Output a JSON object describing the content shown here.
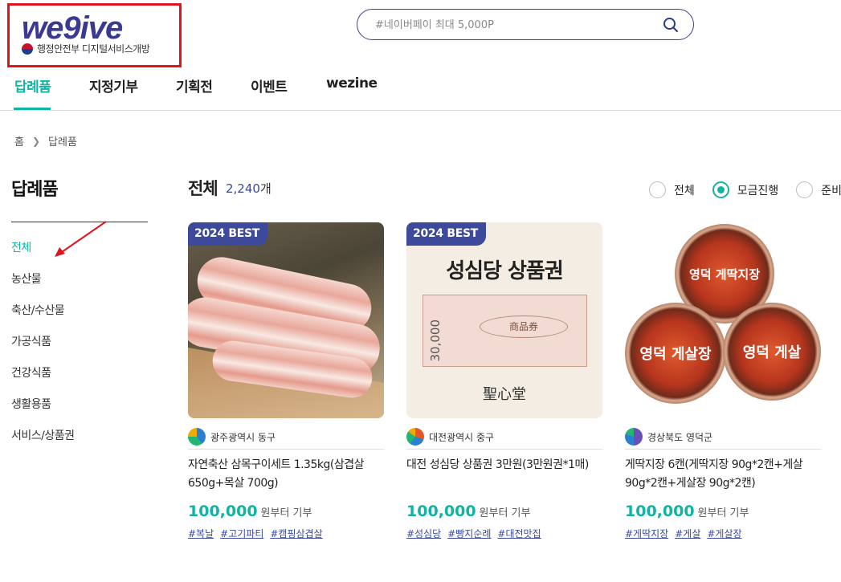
{
  "header": {
    "logo_text": "we9ive",
    "logo_sub": "행정안전부 디지털서비스개방",
    "search_placeholder": "#네이버페이 최대 5,000P"
  },
  "gnb": [
    {
      "label": "답례품",
      "active": true
    },
    {
      "label": "지정기부"
    },
    {
      "label": "기획전"
    },
    {
      "label": "이벤트"
    },
    {
      "label": "wezine"
    }
  ],
  "breadcrumb": {
    "home": "홈",
    "current": "답례품"
  },
  "sidebar": {
    "title": "답례품",
    "items": [
      {
        "label": "전체",
        "active": true
      },
      {
        "label": "농산물"
      },
      {
        "label": "축산/수산물"
      },
      {
        "label": "가공식품"
      },
      {
        "label": "건강식품"
      },
      {
        "label": "생활용품"
      },
      {
        "label": "서비스/상품권"
      }
    ]
  },
  "main": {
    "title": "전체",
    "count": "2,240",
    "count_unit": "개",
    "filters": [
      {
        "label": "전체",
        "checked": false
      },
      {
        "label": "모금진행",
        "checked": true
      },
      {
        "label": "준비"
      }
    ]
  },
  "products": [
    {
      "badge": "2024 BEST",
      "region": "광주광역시 동구",
      "name": "자연축산 삼목구이세트 1.35kg(삼겹살 650g+목살 700g)",
      "price": "100,000",
      "price_unit": "원부터 기부",
      "tags": [
        "#복날",
        "#고기파티",
        "#캠핑삼겹살"
      ],
      "region_color": "#2a7fd1"
    },
    {
      "badge": "2024 BEST",
      "region": "대전광역시 중구",
      "name": "대전 성심당 상품권 3만원(3만원권*1매)",
      "price": "100,000",
      "price_unit": "원부터 기부",
      "tags": [
        "#성심당",
        "#빵지순례",
        "#대전맛집"
      ],
      "image_text": {
        "head": "성심당 상품권",
        "amount": "30,000",
        "stamp": "商品券",
        "sign": "聖心堂"
      },
      "region_color": "#e2572a"
    },
    {
      "badge": "",
      "region": "경상북도 영덕군",
      "name": "게딱지장 6캔(게딱지장 90g*2캔+게살 90g*2캔+게살장 90g*2캔)",
      "price": "100,000",
      "price_unit": "원부터 기부",
      "tags": [
        "#게딱지장",
        "#게살",
        "#게살장"
      ],
      "image_text": {
        "can1": "영덕 게딱지장",
        "can2": "영덕 게살장",
        "can3": "영덕 게살"
      },
      "region_color": "#6a4fb4"
    }
  ]
}
